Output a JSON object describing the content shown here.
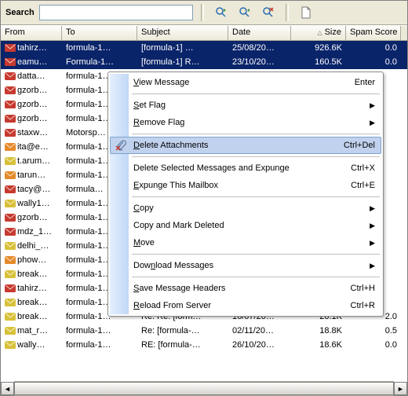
{
  "search": {
    "label": "Search",
    "value": "",
    "placeholder": ""
  },
  "toolbar_icons": [
    "find-next-icon",
    "find-prev-icon",
    "clear-icon",
    "new-icon"
  ],
  "columns": [
    {
      "key": "from",
      "label": "From",
      "w": "w0"
    },
    {
      "key": "to",
      "label": "To",
      "w": "w1"
    },
    {
      "key": "subject",
      "label": "Subject",
      "w": "w2"
    },
    {
      "key": "date",
      "label": "Date",
      "w": "w3"
    },
    {
      "key": "size",
      "label": "Size",
      "w": "w4",
      "sort": true
    },
    {
      "key": "spam",
      "label": "Spam Score",
      "w": "w5"
    }
  ],
  "rows": [
    {
      "sel": true,
      "ic": "red",
      "from": "tahirz…",
      "to": "formula-1…",
      "subj": "[formula-1] …",
      "date": "25/08/20…",
      "size": "926.6K",
      "spam": "0.0"
    },
    {
      "sel": true,
      "ic": "red",
      "from": "eamu…",
      "to": "Formula-1…",
      "subj": "[formula-1] R…",
      "date": "23/10/20…",
      "size": "160.5K",
      "spam": "0.0"
    },
    {
      "ic": "red",
      "from": "datta…",
      "to": "formula-1…"
    },
    {
      "ic": "red",
      "from": "gzorb…",
      "to": "formula-1…"
    },
    {
      "ic": "red",
      "from": "gzorb…",
      "to": "formula-1…"
    },
    {
      "ic": "red",
      "from": "gzorb…",
      "to": "formula-1…"
    },
    {
      "ic": "red",
      "from": "staxw…",
      "to": "Motorsp…"
    },
    {
      "ic": "org",
      "from": "ita@e…",
      "to": "formula-1…"
    },
    {
      "ic": "yel",
      "from": "t.arum…",
      "to": "formula-1…"
    },
    {
      "ic": "org",
      "from": "tarun…",
      "to": "formula-1…"
    },
    {
      "ic": "red",
      "from": "tacy@…",
      "to": "formula…"
    },
    {
      "ic": "yel",
      "from": "wally1…",
      "to": "formula-1…"
    },
    {
      "ic": "red",
      "from": "gzorb…",
      "to": "formula-1…"
    },
    {
      "ic": "red",
      "from": "mdz_1…",
      "to": "formula-1…"
    },
    {
      "ic": "yel",
      "from": "delhi_…",
      "to": "formula-1…"
    },
    {
      "ic": "org",
      "from": "phow…",
      "to": "formula-1…"
    },
    {
      "ic": "yel",
      "from": "break…",
      "to": "formula-1…"
    },
    {
      "ic": "red",
      "from": "tahirz…",
      "to": "formula-1…"
    },
    {
      "ic": "yel",
      "from": "break…",
      "to": "formula-1…"
    },
    {
      "ic": "yel",
      "from": "break…",
      "to": "formula-1…",
      "subj": "Re: Re: [form…",
      "date": "16/07/20…",
      "size": "20.1K",
      "spam": "2.0"
    },
    {
      "ic": "yel",
      "from": "mat_r…",
      "to": "formula-1…",
      "subj": "Re: [formula-…",
      "date": "02/11/20…",
      "size": "18.8K",
      "spam": "0.5"
    },
    {
      "ic": "yel",
      "from": "wally…",
      "to": "formula-1…",
      "subj": "RE: [formula-…",
      "date": "26/10/20…",
      "size": "18.6K",
      "spam": "0.0"
    }
  ],
  "menu": [
    {
      "t": "item",
      "label": "View Message",
      "u": 0,
      "sc": "Enter"
    },
    {
      "t": "sep"
    },
    {
      "t": "item",
      "label": "Set Flag",
      "u": 0,
      "sub": true
    },
    {
      "t": "item",
      "label": "Remove Flag",
      "u": 0,
      "sub": true
    },
    {
      "t": "sep"
    },
    {
      "t": "item",
      "label": "Delete Attachments",
      "u": 0,
      "sc": "Ctrl+Del",
      "hov": true,
      "icon": "attach"
    },
    {
      "t": "sep"
    },
    {
      "t": "item",
      "label": "Delete Selected Messages and Expunge",
      "sc": "Ctrl+X"
    },
    {
      "t": "item",
      "label": "Expunge This Mailbox",
      "u": 0,
      "sc": "Ctrl+E"
    },
    {
      "t": "sep"
    },
    {
      "t": "item",
      "label": "Copy",
      "u": 0,
      "sub": true
    },
    {
      "t": "item",
      "label": "Copy and Mark Deleted",
      "sub": true
    },
    {
      "t": "item",
      "label": "Move",
      "u": 0,
      "sub": true
    },
    {
      "t": "sep"
    },
    {
      "t": "item",
      "label": "Download Messages",
      "u": 3,
      "sub": true
    },
    {
      "t": "sep"
    },
    {
      "t": "item",
      "label": "Save Message Headers",
      "u": 0,
      "sc": "Ctrl+H"
    },
    {
      "t": "item",
      "label": "Reload From Server",
      "u": 0,
      "sc": "Ctrl+R"
    }
  ],
  "icon_colors": {
    "red": "#c73a2f",
    "org": "#e58a2a",
    "yel": "#d8c13a"
  }
}
